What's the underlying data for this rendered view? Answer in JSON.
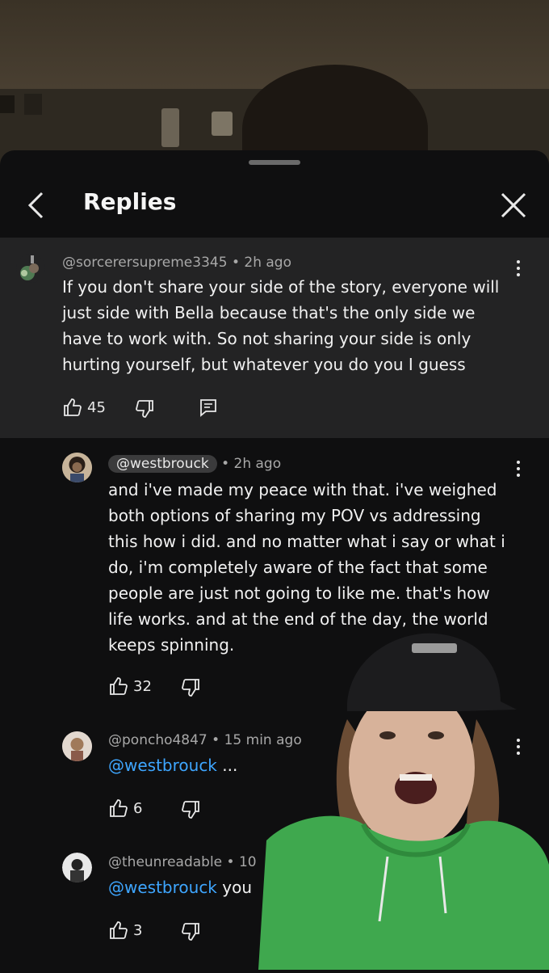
{
  "header": {
    "title": "Replies"
  },
  "main_comment": {
    "handle": "@sorcerersupreme3345",
    "time": "2h ago",
    "lines": [
      "If you don't share your side of the story, everyone will",
      "just side with Bella because that's the only side we",
      "have to work with. So not sharing your side is only",
      "hurting yourself, but whatever you do you I guess"
    ],
    "likes": "45"
  },
  "replies": [
    {
      "handle": "@westbrouck",
      "time": "2h ago",
      "lines": [
        "and i've made my peace with that. i've weighed",
        "both options of sharing my POV vs addressing",
        "this how i did. and no matter what i say or what i",
        "do, i'm completely aware of the fact that some",
        "people are just not going to like me. that's how",
        "life works. and at the end of the day, the world",
        "keeps spinning."
      ],
      "likes": "32"
    },
    {
      "handle": "@poncho4847",
      "time": "15 min ago",
      "mention": "@westbrouck",
      "text": "...",
      "likes": "6"
    },
    {
      "handle": "@theunreadable",
      "time": "10",
      "mention": "@westbrouck",
      "text": "you",
      "likes": "3"
    }
  ],
  "colors": {
    "accent": "#3ea6ff",
    "sheet": "#0f0f10",
    "highlight": "#232324"
  },
  "icons": [
    "back-chevron-icon",
    "close-icon",
    "thumbs-up-icon",
    "thumbs-down-icon",
    "reply-icon",
    "more-vert-icon"
  ]
}
